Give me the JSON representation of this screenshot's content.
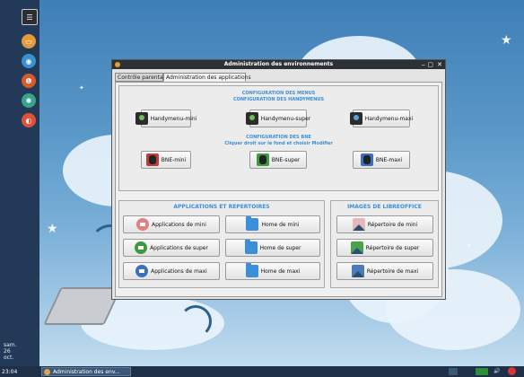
{
  "window": {
    "title": "Administration des environnements",
    "controls": [
      "‒",
      "▢",
      "✕"
    ]
  },
  "tabs": [
    {
      "label": "Contrôle parental",
      "active": false
    },
    {
      "label": "Administration des applications",
      "active": true
    }
  ],
  "menus": {
    "heading1": "CONFIGURATION DES MENUS",
    "heading2": "CONFIGURATION DES HANDYMENUS",
    "handymenu_buttons": [
      "Handymenu-mini",
      "Handymenu-super",
      "Handymenu-maxi"
    ],
    "bne_heading": "CONFIGURATION DES BNE",
    "bne_subheading": "Cliquer droit sur le fond et choisir Modifier",
    "bne_buttons": [
      "BNE-mini",
      "BNE-super",
      "BNE-maxi"
    ]
  },
  "apps": {
    "heading": "APPLICATIONS ET REPERTOIRES",
    "app_buttons": [
      "Applications de mini",
      "Applications de super",
      "Applications de maxi"
    ],
    "home_buttons": [
      "Home de mini",
      "Home de super",
      "Home de maxi"
    ]
  },
  "libreoffice": {
    "heading": "IMAGES DE LIBREOFFICE",
    "buttons": [
      "Répertoire de mini",
      "Répertoire de super",
      "Répertoire de maxi"
    ]
  },
  "desktop": {
    "date_line1": "sam.",
    "date_line2": "26",
    "date_line3": "oct.",
    "time": "23:04",
    "taskbar_task": "Administration des env..."
  },
  "colors": {
    "accent": "#3c8fd6",
    "titlebar": "#2d3136",
    "panel_bg": "#223a57"
  }
}
